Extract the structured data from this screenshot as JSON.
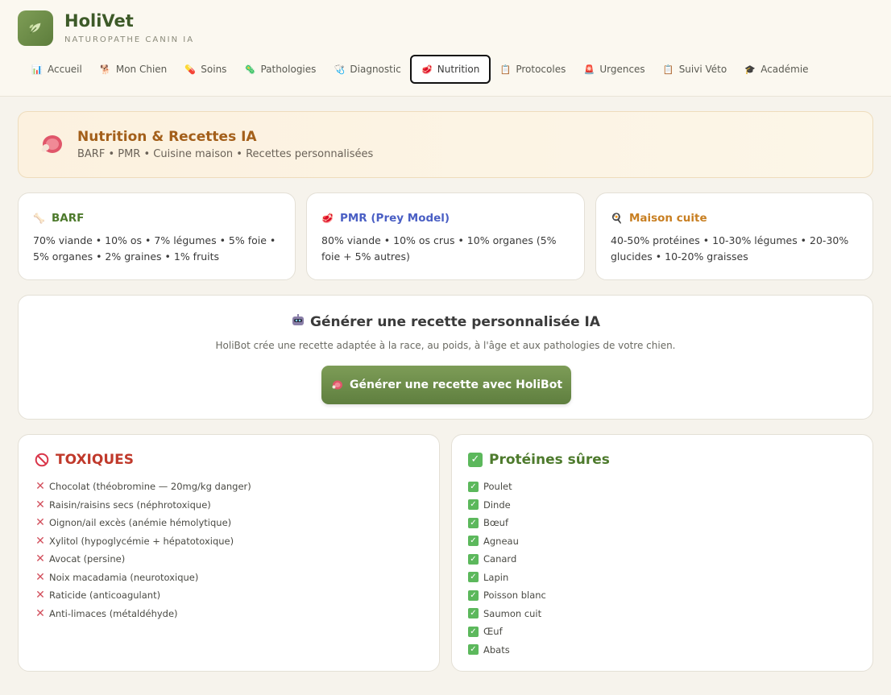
{
  "brand": {
    "title": "HoliVet",
    "subtitle": "NATUROPATHE CANIN IA"
  },
  "nav": [
    {
      "label": "Accueil",
      "icon": "📊"
    },
    {
      "label": "Mon Chien",
      "icon": "🐕"
    },
    {
      "label": "Soins",
      "icon": "💊"
    },
    {
      "label": "Pathologies",
      "icon": "🦠"
    },
    {
      "label": "Diagnostic",
      "icon": "🩺"
    },
    {
      "label": "Nutrition",
      "icon": "🥩"
    },
    {
      "label": "Protocoles",
      "icon": "📋"
    },
    {
      "label": "Urgences",
      "icon": "🚨"
    },
    {
      "label": "Suivi Véto",
      "icon": "📋"
    },
    {
      "label": "Académie",
      "icon": "🎓"
    }
  ],
  "banner": {
    "title": "Nutrition & Recettes IA",
    "subtitle": "BARF • PMR • Cuisine maison • Recettes personnalisées"
  },
  "diets": [
    {
      "title": "BARF",
      "color": "#4d7a2c",
      "icon": "🦴",
      "text": "70% viande • 10% os • 7% légumes • 5% foie • 5% organes • 2% graines • 1% fruits"
    },
    {
      "title": "PMR (Prey Model)",
      "color": "#4a5fc4",
      "icon": "🥩",
      "text": "80% viande • 10% os crus • 10% organes (5% foie + 5% autres)"
    },
    {
      "title": "Maison cuite",
      "color": "#c87f22",
      "icon": "🍳",
      "text": "40-50% protéines • 10-30% légumes • 20-30% glucides • 10-20% graisses"
    }
  ],
  "generator": {
    "title": "Générer une recette personnalisée IA",
    "subtitle": "HoliBot crée une recette adaptée à la race, au poids, à l'âge et aux pathologies de votre chien.",
    "button": "Générer une recette avec HoliBot"
  },
  "toxic": {
    "title": "TOXIQUES",
    "items": [
      "Chocolat (théobromine — 20mg/kg danger)",
      "Raisin/raisins secs (néphrotoxique)",
      "Oignon/ail excès (anémie hémolytique)",
      "Xylitol (hypoglycémie + hépatotoxique)",
      "Avocat (persine)",
      "Noix macadamia (neurotoxique)",
      "Raticide (anticoagulant)",
      "Anti-limaces (métaldéhyde)"
    ]
  },
  "safe": {
    "title": "Protéines sûres",
    "items": [
      "Poulet",
      "Dinde",
      "Bœuf",
      "Agneau",
      "Canard",
      "Lapin",
      "Poisson blanc",
      "Saumon cuit",
      "Œuf",
      "Abats"
    ]
  },
  "colors": {
    "brand": "#3d5a28",
    "accent": "#6f8f4b",
    "danger": "#c0392b",
    "safe": "#4d7a2c",
    "banner": "#a35f1a"
  }
}
